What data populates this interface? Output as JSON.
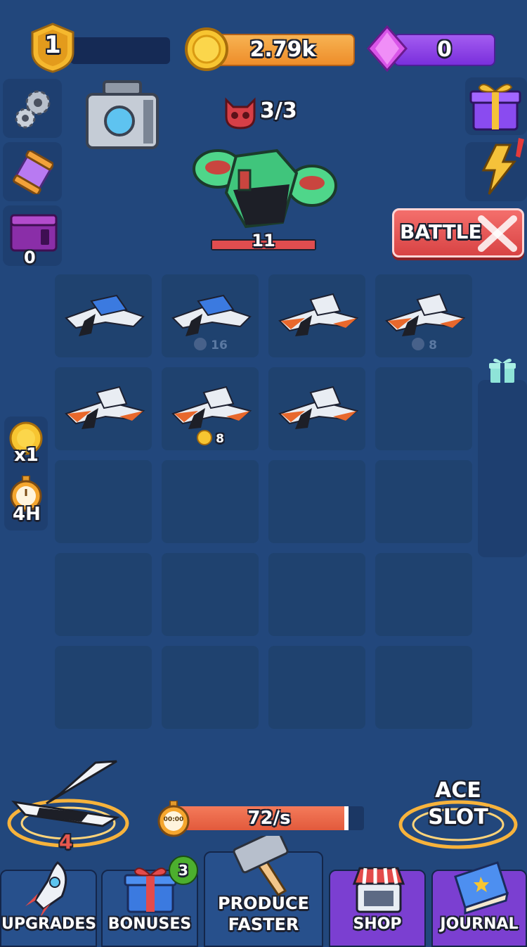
{
  "hud": {
    "level": "1",
    "coins": "2.79k",
    "gems": "0"
  },
  "left_panel": {
    "crate_count": "0",
    "coin_multiplier": "x1",
    "boost_duration": "4H"
  },
  "boss": {
    "kills": "3/3",
    "level": "11",
    "health_fraction": 1.0
  },
  "battle_button": {
    "label": "BATTLE"
  },
  "grid": {
    "cells": [
      {
        "item": "blue-jet",
        "label": ""
      },
      {
        "item": "blue-jet",
        "label": "16",
        "label_icon": "shield-icon",
        "faded": true
      },
      {
        "item": "orange-jet",
        "label": ""
      },
      {
        "item": "orange-jet",
        "label": "8",
        "label_icon": "shield-icon",
        "faded": true
      },
      {
        "item": "orange-jet",
        "label": ""
      },
      {
        "item": "orange-jet",
        "label": "8",
        "label_icon": "coin-icon"
      },
      {
        "item": "orange-jet",
        "label": ""
      },
      {
        "item": "",
        "label": ""
      },
      {
        "item": "",
        "label": ""
      },
      {
        "item": "",
        "label": ""
      },
      {
        "item": "",
        "label": ""
      },
      {
        "item": "",
        "label": ""
      },
      {
        "item": "",
        "label": ""
      },
      {
        "item": "",
        "label": ""
      },
      {
        "item": "",
        "label": ""
      },
      {
        "item": "",
        "label": ""
      },
      {
        "item": "",
        "label": ""
      },
      {
        "item": "",
        "label": ""
      },
      {
        "item": "",
        "label": ""
      },
      {
        "item": "",
        "label": ""
      }
    ]
  },
  "production": {
    "rate": "72/s",
    "progress": 0.92,
    "timer_icon_text": "00:00"
  },
  "ace": {
    "current_level": "4",
    "slot_label_line1": "ACE",
    "slot_label_line2": "SLOT"
  },
  "nav": {
    "upgrades": "UPGRADES",
    "bonuses": "BONUSES",
    "bonuses_badge": "3",
    "produce_line1": "PRODUCE",
    "produce_line2": "FASTER",
    "shop": "SHOP",
    "journal": "JOURNAL"
  },
  "colors": {
    "background": "#22477c",
    "coin_bar": "#f0962f",
    "gem_bar": "#8a3ee6",
    "battle_button": "#e8595a",
    "badge": "#4caf2e"
  }
}
